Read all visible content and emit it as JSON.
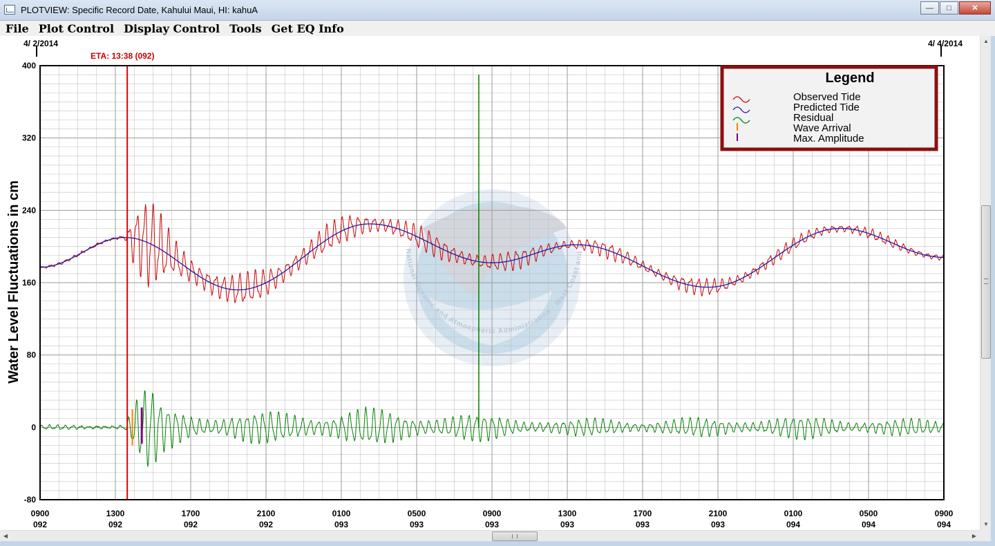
{
  "window": {
    "title": "PLOTVIEW: Specific Record Date, Kahului Maui, HI: kahuA",
    "btn_min": "—",
    "btn_max": "□",
    "btn_close": "✕"
  },
  "menu": [
    "File",
    "Plot Control",
    "Display Control",
    "Tools",
    "Get EQ Info"
  ],
  "header": {
    "start_date": "4/ 2/2014",
    "end_date": "4/ 4/2014",
    "eta_label": "ETA: 13:38 (092)"
  },
  "legend": {
    "title": "Legend",
    "items": [
      "Observed Tide",
      "Predicted Tide",
      "Residual",
      "Wave Arrival",
      "Max. Amplitude"
    ]
  },
  "watermark_text": "National Oceanic and Atmospheric Administration · West Coast and Alaska Tsunami Warning Center",
  "colors": {
    "observed": "#cc0000",
    "predicted": "#1a1aa8",
    "residual": "#008000",
    "wave_arrival": "#ff8000",
    "max_amplitude": "#800080",
    "eta_line": "#e00000",
    "legend_border": "#8b1010",
    "grid": "#c0c0c0"
  },
  "chart_data": {
    "type": "line",
    "title": "",
    "xlabel": "",
    "ylabel": "Water Level Fluctuations in cm",
    "xlim_hours": [
      0,
      48
    ],
    "ylim": [
      -80,
      400
    ],
    "y_ticks": [
      -80,
      0,
      80,
      160,
      240,
      320,
      400
    ],
    "grid": true,
    "legend_position": "top-right",
    "x_tick_hours": [
      0,
      4,
      8,
      12,
      16,
      20,
      24,
      28,
      32,
      36,
      40,
      44,
      48
    ],
    "x_ticks_time": [
      "0900",
      "1300",
      "1700",
      "2100",
      "0100",
      "0500",
      "0900",
      "1300",
      "1700",
      "2100",
      "0100",
      "0500",
      "0900"
    ],
    "x_ticks_day": [
      "092",
      "092",
      "092",
      "092",
      "093",
      "093",
      "093",
      "093",
      "093",
      "093",
      "094",
      "094",
      "094"
    ],
    "eta_hour": 4.63,
    "wave_arrival_hour": 4.9,
    "max_amplitude_hour": 5.4,
    "spike": {
      "hour": 23.3,
      "value": 390
    },
    "predicted_tide": {
      "hours": [
        0,
        4.5,
        10.5,
        17.5,
        24,
        28.5,
        35.5,
        42.5,
        48
      ],
      "values": [
        177,
        210,
        152,
        225,
        182,
        202,
        155,
        220,
        188
      ]
    },
    "observed_noise_envelope": {
      "hours": [
        0,
        4.5,
        5.0,
        5.8,
        7,
        10,
        12,
        17,
        24,
        28,
        36,
        40,
        48
      ],
      "values": [
        1,
        2,
        30,
        42,
        22,
        14,
        16,
        12,
        10,
        7,
        8,
        6,
        4
      ]
    },
    "residual_envelope": {
      "hours": [
        0,
        4.5,
        5.0,
        5.8,
        6.5,
        8,
        12,
        17,
        24,
        28,
        36,
        40,
        48
      ],
      "values": [
        2,
        3,
        28,
        42,
        22,
        16,
        15,
        18,
        12,
        8,
        9,
        11,
        7
      ]
    }
  }
}
